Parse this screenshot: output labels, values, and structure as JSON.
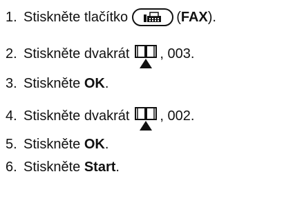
{
  "steps": [
    {
      "number": "1.",
      "prefix": "Stiskněte tlačítko",
      "paren_open": "(",
      "bold": "FAX",
      "paren_close": ").",
      "icon": "fax-button-icon"
    },
    {
      "number": "2.",
      "prefix": "Stiskněte dvakrát",
      "suffix": ", 003.",
      "icon": "address-book-down-icon"
    },
    {
      "number": "3.",
      "prefix": "Stiskněte",
      "bold": "OK",
      "suffix": "."
    },
    {
      "number": "4.",
      "prefix": "Stiskněte dvakrát",
      "suffix": ", 002.",
      "icon": "address-book-down-icon"
    },
    {
      "number": "5.",
      "prefix": "Stiskněte",
      "bold": "OK",
      "suffix": "."
    },
    {
      "number": "6.",
      "prefix": "Stiskněte",
      "bold": "Start",
      "suffix": "."
    }
  ]
}
